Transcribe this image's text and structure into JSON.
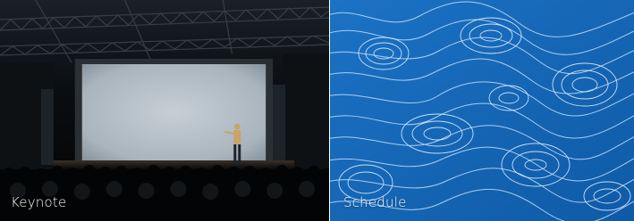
{
  "tiles": [
    {
      "label": "Keynote",
      "image": "keynote-stage-photo"
    },
    {
      "label": "Schedule",
      "image": "topographic-contour-pattern"
    }
  ],
  "colors": {
    "keynote_bg": "#050607",
    "schedule_bg": "#1666b8",
    "screen": "#b9c4cc",
    "label_text": "#ffffff"
  }
}
